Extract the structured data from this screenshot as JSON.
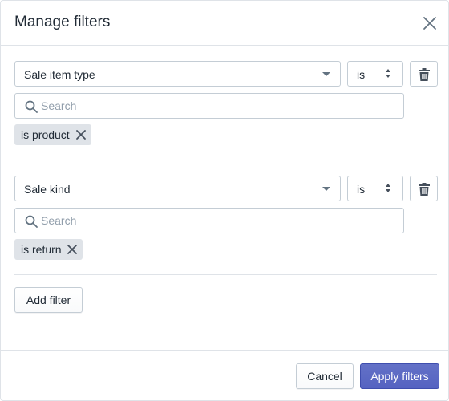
{
  "dialog": {
    "title": "Manage filters",
    "close_icon": "close-icon"
  },
  "filters": [
    {
      "field": "Sale item type",
      "operator": "is",
      "search_placeholder": "Search",
      "search_value": "",
      "tag": "is product"
    },
    {
      "field": "Sale kind",
      "operator": "is",
      "search_placeholder": "Search",
      "search_value": "",
      "tag": "is return"
    }
  ],
  "add_filter_label": "Add filter",
  "footer": {
    "cancel_label": "Cancel",
    "apply_label": "Apply filters"
  },
  "icons": {
    "dropdown": "caret-down-icon",
    "operator": "select-arrows-icon",
    "delete": "trash-icon",
    "search": "search-icon",
    "remove_tag": "close-icon"
  },
  "colors": {
    "primary": "#5c6ac4",
    "border": "#c4cdd5",
    "tag_bg": "#dfe3e8",
    "text": "#212b36",
    "placeholder": "#919eab"
  }
}
